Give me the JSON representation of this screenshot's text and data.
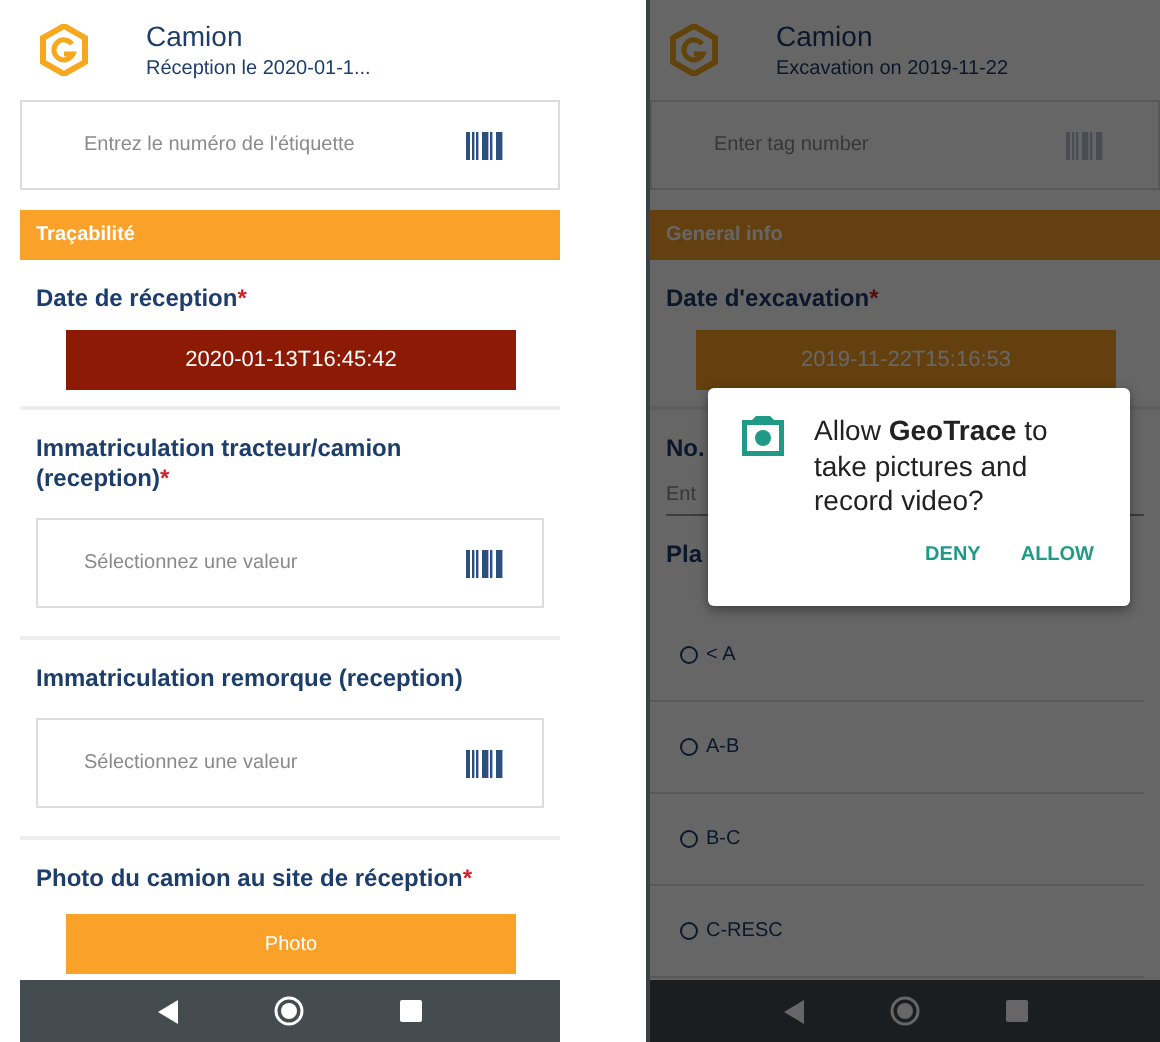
{
  "screens": [
    {
      "header": {
        "title": "Camion",
        "subtitle": "Réception le 2020-01-1..."
      },
      "tag_field": {
        "placeholder": "Entrez le numéro de l'étiquette"
      },
      "section_title": "Traçabilité",
      "fields": [
        {
          "kind": "date",
          "label": "Date de réception",
          "required_mark": "*",
          "value": "2020-01-13T16:45:42",
          "invalid": true
        },
        {
          "kind": "select",
          "label": "Immatriculation tracteur/camion (reception)",
          "required_mark": "*",
          "placeholder": "Sélectionnez une valeur"
        },
        {
          "kind": "select",
          "label": "Immatriculation remorque (reception)",
          "placeholder": "Sélectionnez une valeur"
        },
        {
          "kind": "photo",
          "label": "Photo du camion au site de réception",
          "required_mark": "*",
          "button": "Photo"
        }
      ]
    },
    {
      "header": {
        "title": "Camion",
        "subtitle": "Excavation on 2019-11-22"
      },
      "tag_field": {
        "placeholder": "Enter tag number"
      },
      "section_title": "General info",
      "fields": [
        {
          "kind": "date",
          "label": "Date d'excavation",
          "required_mark": "*",
          "value": "2019-11-22T15:16:53",
          "invalid": false
        },
        {
          "kind": "text",
          "label": "No.",
          "placeholder": "Ent"
        },
        {
          "kind": "radio",
          "label": "Pla",
          "options": [
            {
              "label": "< A",
              "selected": false
            },
            {
              "label": "A-B",
              "selected": false
            },
            {
              "label": "B-C",
              "selected": false
            },
            {
              "label": "C-RESC",
              "selected": false
            }
          ]
        }
      ],
      "dialog": {
        "message": "Allow **GeoTrace** to take pictures and record video?",
        "buttons": [
          "DENY",
          "ALLOW"
        ]
      }
    }
  ]
}
